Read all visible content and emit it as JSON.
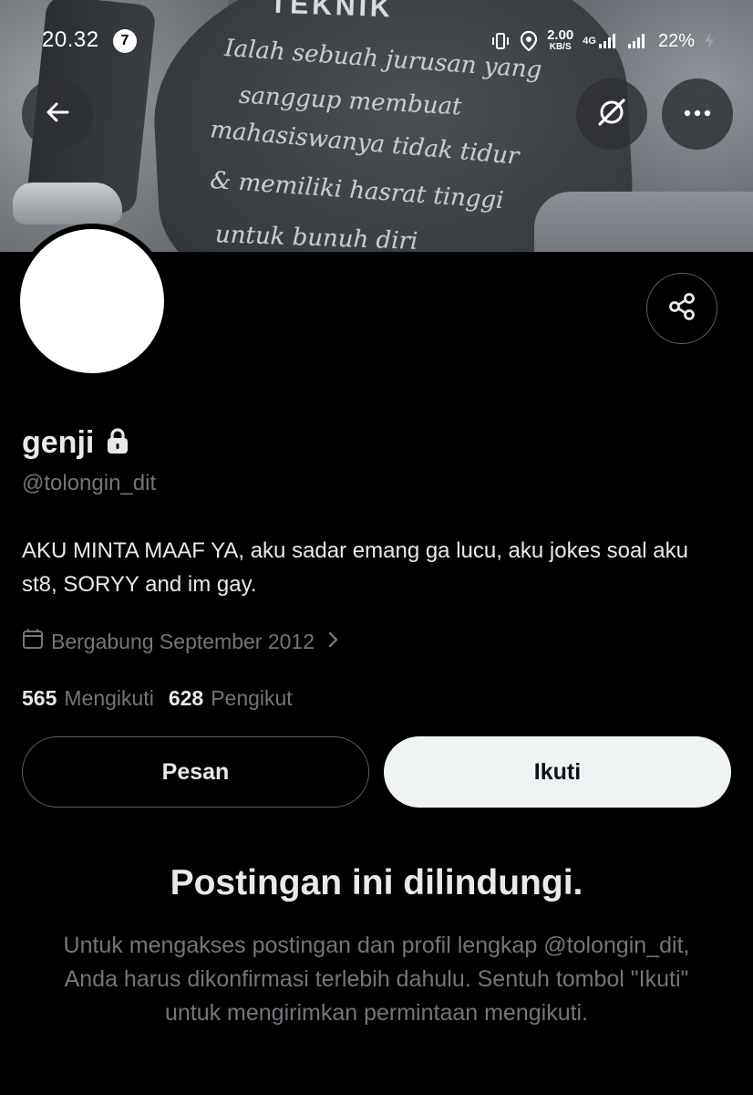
{
  "status_bar": {
    "time": "20.32",
    "notification_count": "7",
    "net_speed_value": "2.00",
    "net_speed_unit": "KB/S",
    "net_type": "4G",
    "battery": "22%"
  },
  "banner": {
    "shirt_lines": [
      "TEKNIK",
      "Ialah sebuah jurusan yang",
      "sanggup membuat",
      "mahasiswanya tidak tidur",
      "& memiliki hasrat tinggi",
      "untuk bunuh diri"
    ]
  },
  "header": {
    "back_icon": "arrow-left-icon",
    "grok_icon": "grok-icon",
    "more_icon": "more-horizontal-icon"
  },
  "profile": {
    "display_name": "genji",
    "lock_icon": "lock-icon",
    "handle": "@tolongin_dit",
    "bio": "AKU MINTA MAAF YA, aku sadar emang ga lucu, aku jokes soal aku st8, SORYY and im gay.",
    "joined": "Bergabung September 2012",
    "following_count": "565",
    "following_label": "Mengikuti",
    "followers_count": "628",
    "followers_label": "Pengikut"
  },
  "actions": {
    "message_label": "Pesan",
    "follow_label": "Ikuti",
    "share_icon": "share-icon"
  },
  "protected": {
    "title": "Postingan ini dilindungi.",
    "description": "Untuk mengakses postingan dan profil lengkap @tolongin_dit, Anda harus dikonfirmasi terlebih dahulu. Sentuh tombol \"Ikuti\" untuk mengirimkan permintaan mengikuti."
  },
  "colors": {
    "background": "#000000",
    "primary_text": "#e7e9ea",
    "secondary_text": "#71767b",
    "border": "#536471",
    "follow_button_bg": "#eff3f4"
  }
}
